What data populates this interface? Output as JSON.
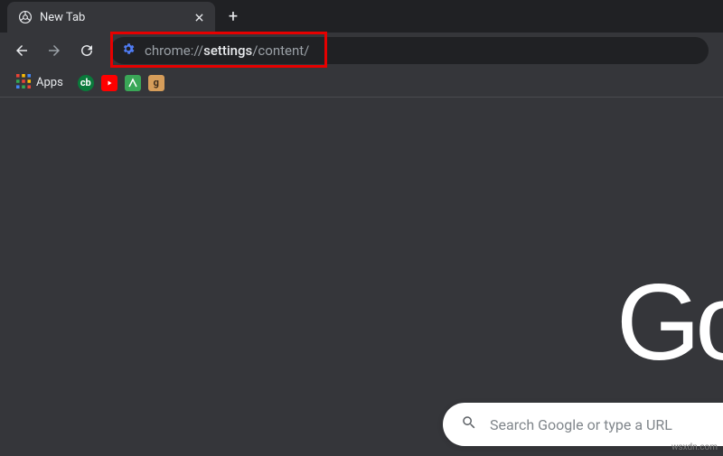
{
  "tab": {
    "title": "New Tab"
  },
  "omnibox": {
    "pre": "chrome://",
    "bold": "settings",
    "post": "/content/"
  },
  "bookmarks": {
    "apps_label": "Apps"
  },
  "logo": {
    "partial_text": "Go"
  },
  "search": {
    "placeholder": "Search Google or type a URL"
  },
  "watermark": "wsxdn.com"
}
